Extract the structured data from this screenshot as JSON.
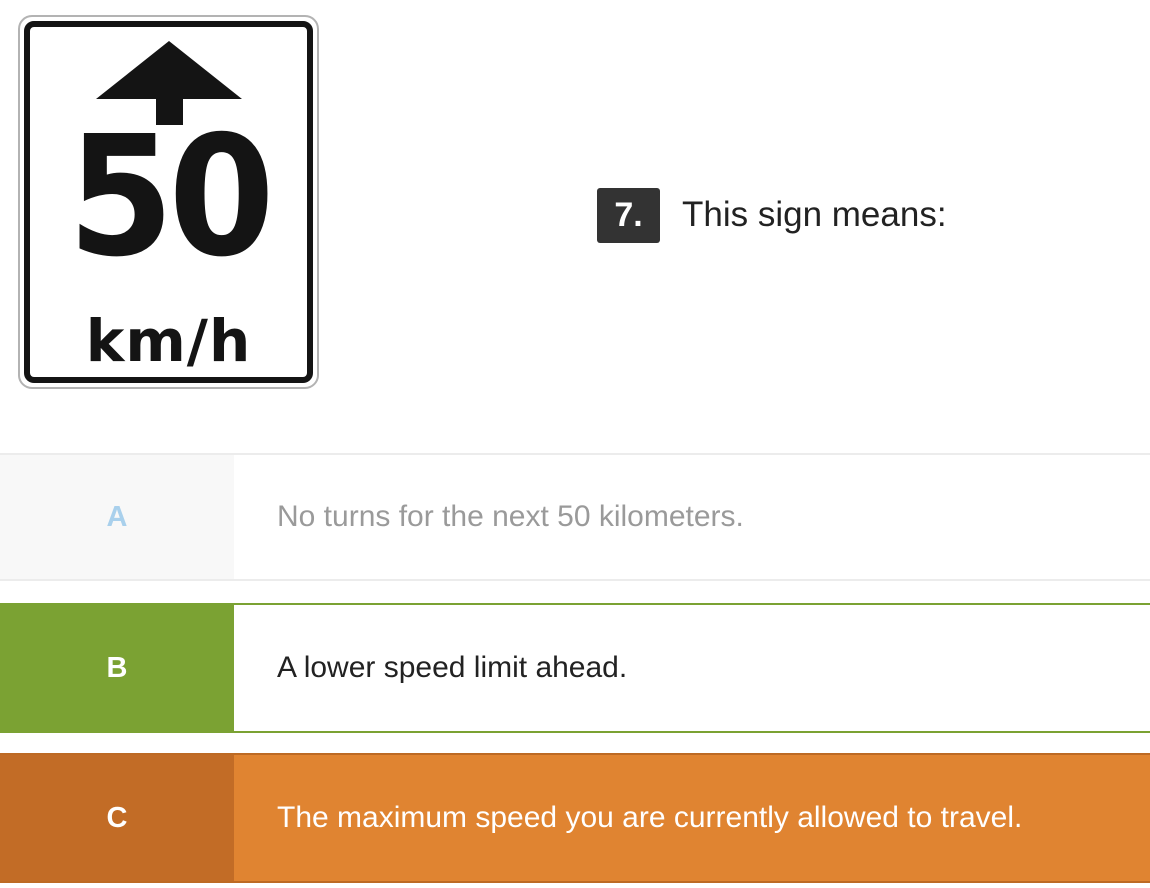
{
  "sign": {
    "arrow_icon": "arrow-up-icon",
    "speed": "50",
    "unit": "km/h"
  },
  "question": {
    "number": "7.",
    "text": "This sign means:"
  },
  "answers": [
    {
      "letter": "A",
      "text": "No turns for the next 50 kilometers.",
      "state": "neutral"
    },
    {
      "letter": "B",
      "text": "A lower speed limit ahead.",
      "state": "correct",
      "color": "#7ba233"
    },
    {
      "letter": "C",
      "text": "The maximum speed you are currently allowed to travel.",
      "state": "incorrect-selected",
      "color": "#e08431"
    }
  ]
}
